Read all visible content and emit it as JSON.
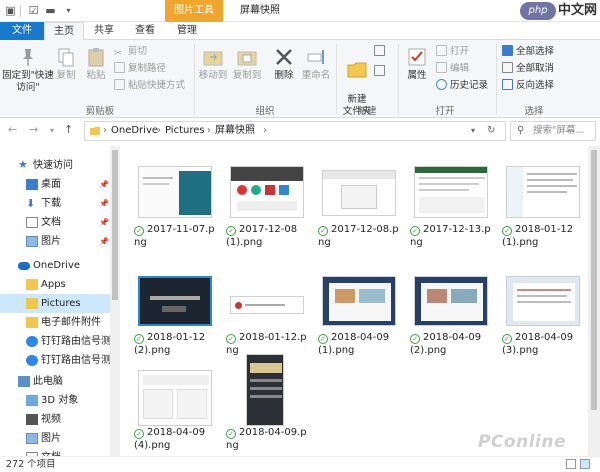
{
  "titlebar": {
    "context_tab": "图片工具",
    "title": "屏幕快照",
    "logo_badge": "php",
    "logo_text": "中文网"
  },
  "tabs": [
    "文件",
    "主页",
    "共享",
    "查看",
    "管理"
  ],
  "ribbon": {
    "clipboard": {
      "pin_label": "固定到\"快速访问\"",
      "copy_label": "复制",
      "paste_label": "粘贴",
      "cut_label": "剪切",
      "copy_path_label": "复制路径",
      "paste_shortcut_label": "粘贴快捷方式",
      "group_label": "剪贴板"
    },
    "organize": {
      "move_to_label": "移动到",
      "copy_to_label": "复制到",
      "delete_label": "删除",
      "rename_label": "重命名",
      "group_label": "组织"
    },
    "new": {
      "new_folder_label": "新建\n文件夹",
      "group_label": "新建"
    },
    "open": {
      "properties_label": "属性",
      "open_label": "打开",
      "edit_label": "编辑",
      "history_label": "历史记录",
      "group_label": "打开"
    },
    "select": {
      "select_all_label": "全部选择",
      "select_none_label": "全部取消",
      "invert_label": "反向选择",
      "group_label": "选择"
    }
  },
  "addressbar": {
    "crumbs": [
      "OneDrive",
      "Pictures",
      "屏幕快照"
    ],
    "search_placeholder": "搜索\"屏幕...",
    "icons": [
      "back-icon",
      "forward-icon",
      "recent-icon",
      "up-icon",
      "refresh-icon",
      "search-icon"
    ]
  },
  "navpane": {
    "items": [
      {
        "label": "快速访问",
        "icon": "star-icon"
      },
      {
        "label": "桌面",
        "icon": "desktop-icon",
        "pinned": true
      },
      {
        "label": "下载",
        "icon": "download-icon",
        "pinned": true
      },
      {
        "label": "文档",
        "icon": "documents-icon",
        "pinned": true
      },
      {
        "label": "图片",
        "icon": "pictures-icon",
        "pinned": true
      },
      {
        "label": "OneDrive",
        "icon": "cloud-icon"
      },
      {
        "label": "Apps",
        "icon": "folder-icon"
      },
      {
        "label": "Pictures",
        "icon": "folder-icon"
      },
      {
        "label": "电子邮件附件",
        "icon": "folder-icon"
      },
      {
        "label": "钉钉路由信号测试",
        "icon": "dingtalk-icon"
      },
      {
        "label": "钉钉路由信号测试",
        "icon": "dingtalk-icon"
      },
      {
        "label": "此电脑",
        "icon": "computer-icon"
      },
      {
        "label": "3D 对象",
        "icon": "3d-objects-icon"
      },
      {
        "label": "视频",
        "icon": "video-icon"
      },
      {
        "label": "图片",
        "icon": "pictures-icon"
      },
      {
        "label": "文档",
        "icon": "documents-icon"
      }
    ]
  },
  "files": [
    {
      "line1": "2017-11-07.p",
      "line2": "ng"
    },
    {
      "line1": "2017-12-08",
      "line2": "(1).png"
    },
    {
      "line1": "2017-12-08.p",
      "line2": "ng"
    },
    {
      "line1": "2017-12-13.p",
      "line2": "ng"
    },
    {
      "line1": "2018-01-12",
      "line2": "(1).png"
    },
    {
      "line1": "2018-01-12",
      "line2": "(2).png"
    },
    {
      "line1": "2018-01-12.p",
      "line2": "ng"
    },
    {
      "line1": "2018-04-09",
      "line2": "(1).png"
    },
    {
      "line1": "2018-04-09",
      "line2": "(2).png"
    },
    {
      "line1": "2018-04-09",
      "line2": "(3).png"
    },
    {
      "line1": "2018-04-09",
      "line2": "(4).png"
    },
    {
      "line1": "2018-04-09.p",
      "line2": "ng"
    }
  ],
  "status": {
    "item_count": "272 个项目"
  },
  "watermark": "PConline",
  "colors": {
    "accent": "#1979ca",
    "context_tab": "#f0a52e",
    "selected": "#cce8ff",
    "sync_check": "#3aa23a"
  }
}
